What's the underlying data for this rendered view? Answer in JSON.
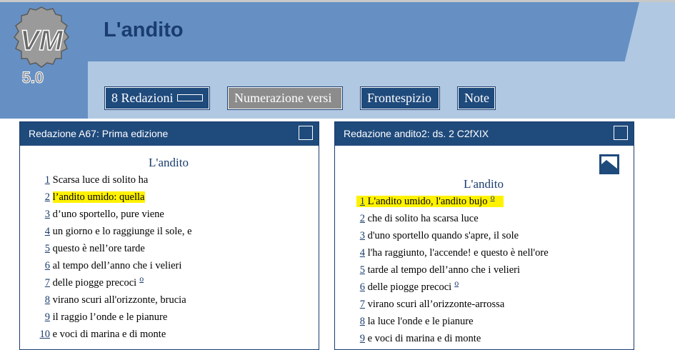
{
  "header": {
    "title": "L'andito",
    "logo_text": "5.0",
    "buttons": [
      {
        "label": "8 Redazioni"
      },
      {
        "label": "Numerazione versi"
      },
      {
        "label": "Frontespizio"
      },
      {
        "label": "Note"
      }
    ]
  },
  "colors": {
    "navy": "#1f4a7c",
    "header_dark": "#6690c4",
    "header_light": "#b0c8e2",
    "highlight": "#fff200"
  },
  "left_panel": {
    "header": "Redazione A67: Prima edizione",
    "poem_title": "L'andito",
    "lines": [
      {
        "num": "1",
        "text": "Scarsa luce di solito ha"
      },
      {
        "num": "2",
        "text": "l’andito umido: quella"
      },
      {
        "num": "3",
        "text": "d’uno sportello, pure viene"
      },
      {
        "num": "4",
        "text": "un giorno e lo raggiunge il sole, e"
      },
      {
        "num": "5",
        "text": "questo è nell’ore tarde"
      },
      {
        "num": "6",
        "text": "al tempo dell’anno che i velieri"
      },
      {
        "num": "7",
        "text": "delle piogge precoci",
        "note": "o"
      },
      {
        "num": "8",
        "text": "virano scuri all'orizzonte, brucia"
      },
      {
        "num": "9",
        "text": "il raggio l’onde e le pianure"
      },
      {
        "num": "10",
        "text": "e voci di marina e di monte"
      }
    ]
  },
  "right_panel": {
    "header": "Redazione andito2: ds. 2 C2fXIX",
    "poem_title": "L'andito",
    "icon": "image-icon",
    "lines": [
      {
        "num": "1",
        "text": "L'andito umido, l'andito bujo",
        "note": "o"
      },
      {
        "num": "2",
        "text": "che di solito ha scarsa luce"
      },
      {
        "num": "3",
        "text": "d'uno sportello quando s'apre, il sole"
      },
      {
        "num": "4",
        "text": "l'ha raggiunto, l'accende! e questo è nell'ore"
      },
      {
        "num": "5",
        "text": "tarde al tempo dell’anno che i velieri"
      },
      {
        "num": "6",
        "text": "delle piogge precoci",
        "note": "o"
      },
      {
        "num": "7",
        "text": "virano scuri all’orizzonte-arrossa"
      },
      {
        "num": "8",
        "text": "la luce l'onde e le pianure"
      },
      {
        "num": "9",
        "text": "e voci di marina e di monte"
      }
    ]
  }
}
